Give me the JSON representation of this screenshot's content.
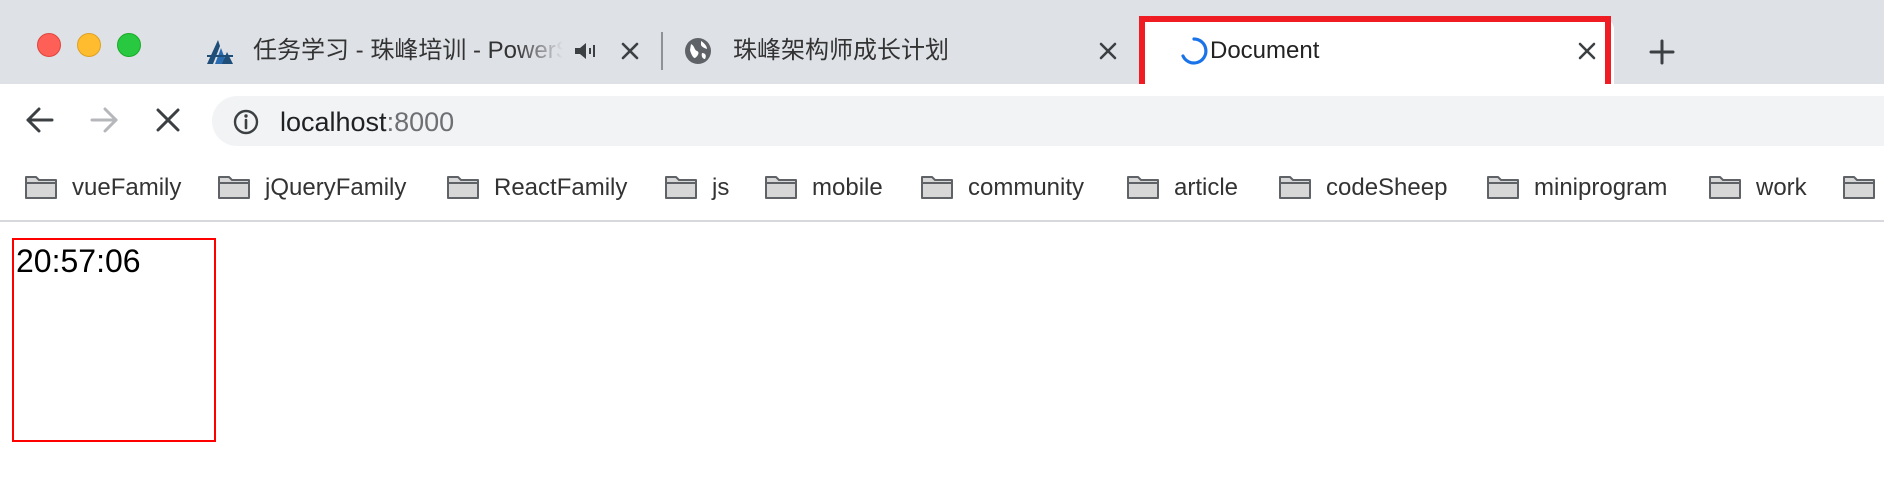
{
  "window": {
    "traffic_lights": [
      "close",
      "minimize",
      "zoom"
    ]
  },
  "tabs": [
    {
      "title": "任务学习 - 珠峰培训 - PowerSchool",
      "favicon": "zhufeng-logo-icon",
      "audio": true,
      "active": false
    },
    {
      "title": "珠峰架构师成长计划",
      "favicon": "globe-icon",
      "active": false
    },
    {
      "title": "Document",
      "favicon": "loading-spinner-icon",
      "active": true,
      "highlighted": true
    }
  ],
  "toolbar": {
    "url_host": "localhost",
    "url_port": ":8000"
  },
  "bookmarks": [
    {
      "label": "vueFamily"
    },
    {
      "label": "jQueryFamily"
    },
    {
      "label": "ReactFamily"
    },
    {
      "label": "js"
    },
    {
      "label": "mobile"
    },
    {
      "label": "community"
    },
    {
      "label": "article"
    },
    {
      "label": "codeSheep"
    },
    {
      "label": "miniprogram"
    },
    {
      "label": "work"
    },
    {
      "label": ""
    }
  ],
  "content": {
    "clock_time": "20:57:06"
  },
  "colors": {
    "highlight": "#ef1c24",
    "clock_border": "#ff0000",
    "tabstrip_bg": "#dee1e6",
    "spinner": "#1a73e8"
  }
}
